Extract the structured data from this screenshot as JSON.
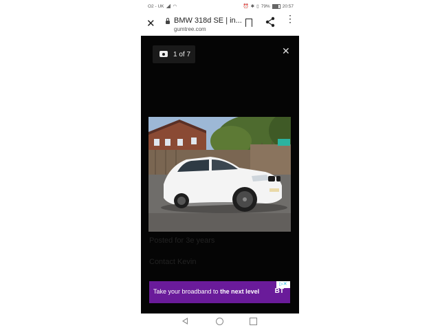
{
  "status_bar": {
    "carrier": "O2 - UK",
    "battery": "79%",
    "time": "20:57"
  },
  "browser": {
    "page_title": "BMW 318d SE | in...",
    "domain": "gumtree.com"
  },
  "viewer": {
    "counter": "1 of 7",
    "bg_texts": [
      "Contact Kevin",
      "Posted for 3e years"
    ]
  },
  "ad": {
    "text_plain": "Take your broadband to ",
    "text_bold": "the next level",
    "brand": "BT",
    "adchoice": "▷✕"
  },
  "colors": {
    "ad_background": "#6a1b9a",
    "viewer_background": "#050505"
  }
}
